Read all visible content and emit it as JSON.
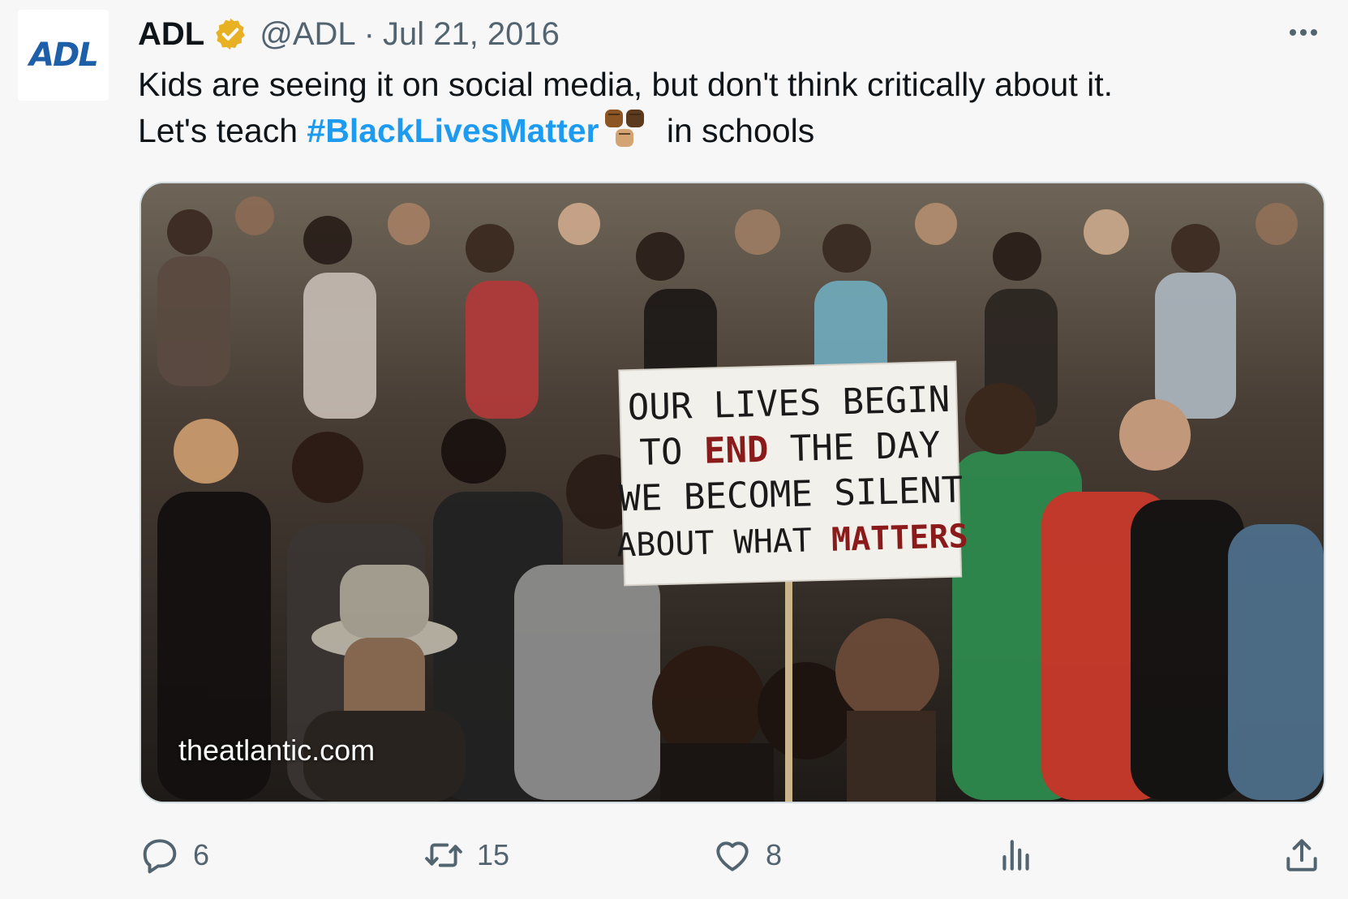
{
  "author": {
    "avatar_text": "ADL",
    "name": "ADL",
    "handle": "@ADL",
    "separator": "·",
    "date": "Jul 21, 2016",
    "verified_color": "#e8b023"
  },
  "tweet": {
    "line1": "Kids are seeing it on social media, but don't think critically about it.",
    "line2_before": "Let's teach ",
    "hashtag": "#BlackLivesMatter",
    "emoji": "raised-fists-emoji",
    "line2_after": " in schools"
  },
  "media": {
    "sign_text": {
      "line1": "OUR LIVES BEGIN",
      "line2a": "TO ",
      "line2b": "END",
      "line2c": " THE DAY",
      "line3": "WE BECOME SILENT",
      "line4a": "ABOUT WHAT ",
      "line4b": "MATTERS"
    },
    "source": "theatlantic.com"
  },
  "actions": {
    "replies": "6",
    "retweets": "15",
    "likes": "8"
  },
  "colors": {
    "link": "#1d9bf0",
    "secondary_text": "#536471",
    "primary_text": "#0f1419"
  },
  "icons": [
    "more-icon",
    "reply-icon",
    "retweet-icon",
    "like-icon",
    "views-icon",
    "share-icon",
    "verified-badge-icon"
  ]
}
